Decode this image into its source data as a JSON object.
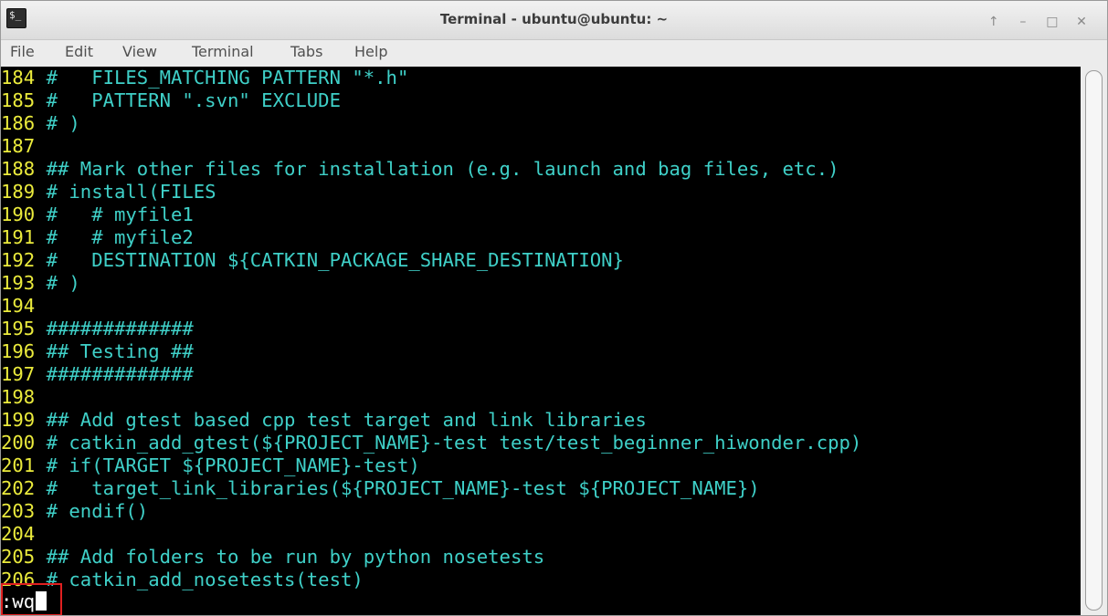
{
  "window": {
    "title": "Terminal - ubuntu@ubuntu: ~",
    "icon": "terminal-icon",
    "controls": [
      "↑",
      "–",
      "□",
      "✕"
    ]
  },
  "menu": [
    "File",
    "Edit",
    "View",
    "Terminal",
    "Tabs",
    "Help"
  ],
  "lines": [
    {
      "n": "184",
      "text": " #   FILES_MATCHING PATTERN \"*.h\""
    },
    {
      "n": "185",
      "text": " #   PATTERN \".svn\" EXCLUDE"
    },
    {
      "n": "186",
      "text": " # )"
    },
    {
      "n": "187",
      "text": ""
    },
    {
      "n": "188",
      "text": " ## Mark other files for installation (e.g. launch and bag files, etc.)"
    },
    {
      "n": "189",
      "text": " # install(FILES"
    },
    {
      "n": "190",
      "text": " #   # myfile1"
    },
    {
      "n": "191",
      "text": " #   # myfile2"
    },
    {
      "n": "192",
      "text": " #   DESTINATION ${CATKIN_PACKAGE_SHARE_DESTINATION}"
    },
    {
      "n": "193",
      "text": " # )"
    },
    {
      "n": "194",
      "text": ""
    },
    {
      "n": "195",
      "text": " #############"
    },
    {
      "n": "196",
      "text": " ## Testing ##"
    },
    {
      "n": "197",
      "text": " #############"
    },
    {
      "n": "198",
      "text": ""
    },
    {
      "n": "199",
      "text": " ## Add gtest based cpp test target and link libraries"
    },
    {
      "n": "200",
      "text": " # catkin_add_gtest(${PROJECT_NAME}-test test/test_beginner_hiwonder.cpp)"
    },
    {
      "n": "201",
      "text": " # if(TARGET ${PROJECT_NAME}-test)"
    },
    {
      "n": "202",
      "text": " #   target_link_libraries(${PROJECT_NAME}-test ${PROJECT_NAME})"
    },
    {
      "n": "203",
      "text": " # endif()"
    },
    {
      "n": "204",
      "text": ""
    },
    {
      "n": "205",
      "text": " ## Add folders to be run by python nosetests"
    },
    {
      "n": "206",
      "text": " # catkin_add_nosetests(test)"
    }
  ],
  "command_line": ":wq",
  "colors": {
    "background": "#000000",
    "line_number": "#ebeb3c",
    "comment": "#3fd0c8",
    "command": "#ffffff",
    "highlight_box": "#e02020"
  }
}
